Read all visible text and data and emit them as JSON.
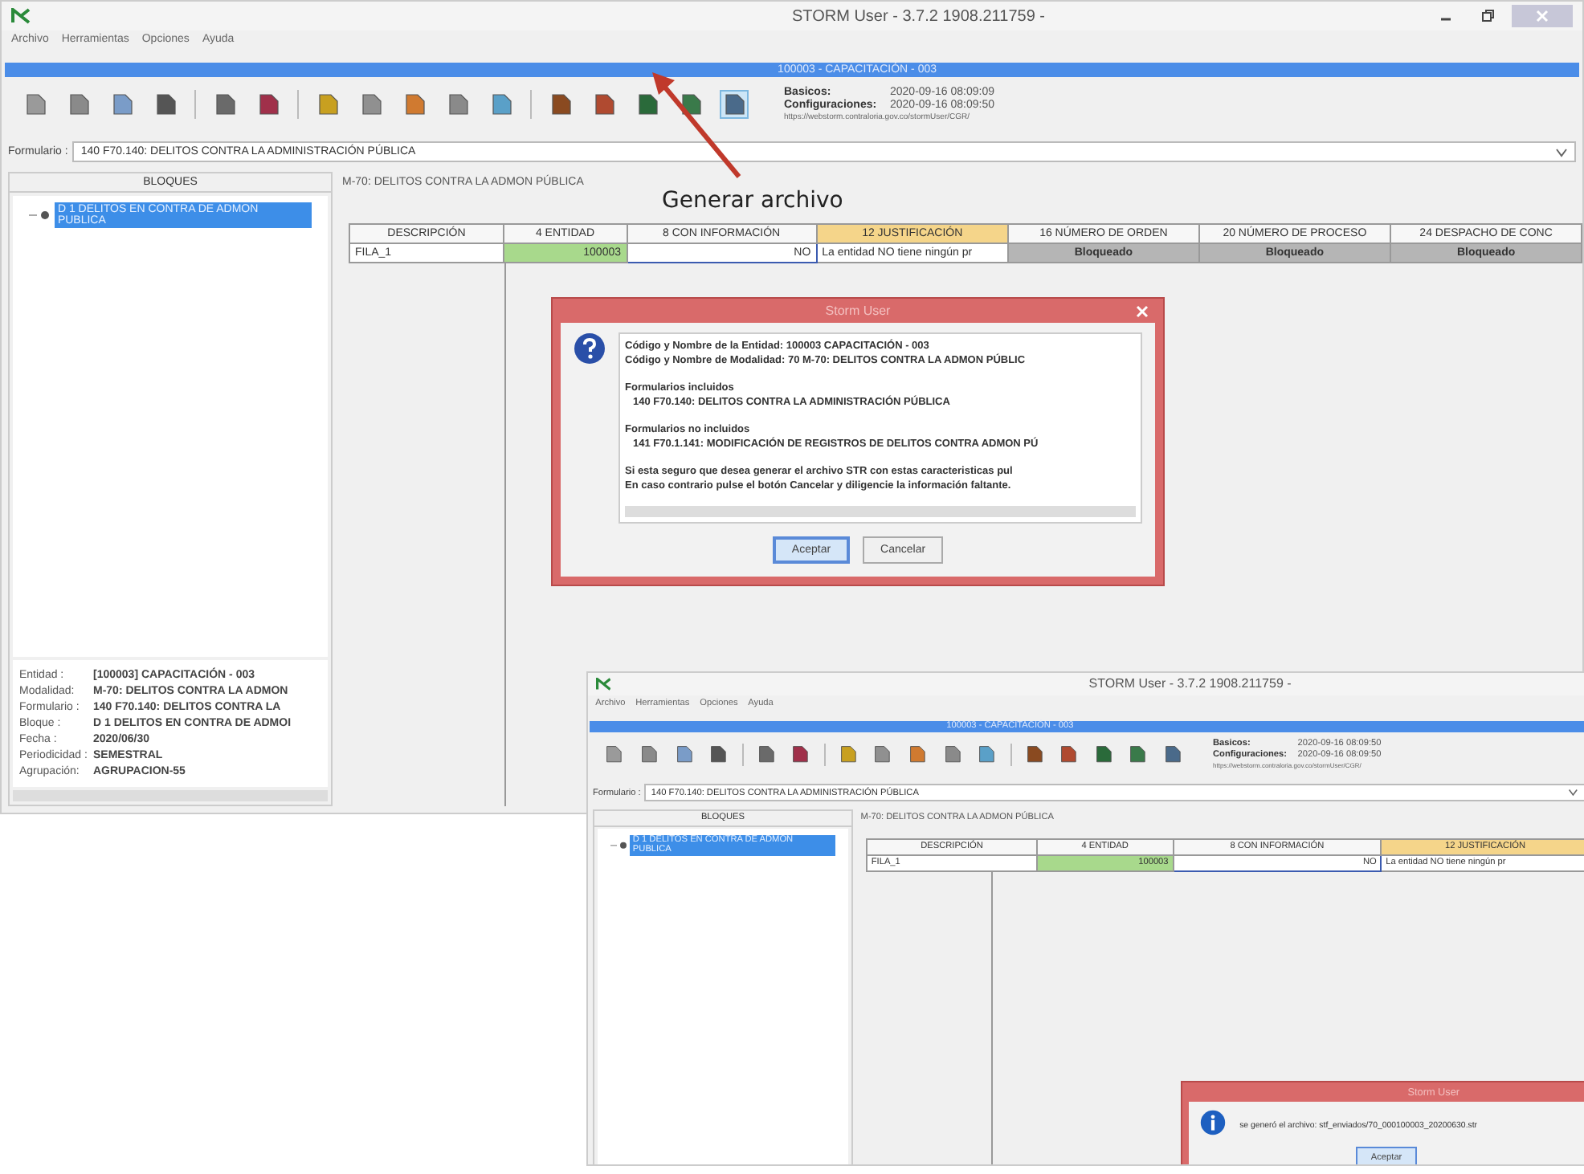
{
  "annotation": {
    "label": "Generar archivo"
  },
  "windows": [
    {
      "kind": "main",
      "title": "STORM User - 3.7.2  1908.211759 -",
      "controls": true,
      "menu": [
        "Archivo",
        "Herramientas",
        "Opciones",
        "Ayuda"
      ],
      "entity_bar": "100003 - CAPACITACIÓN - 003",
      "toolbar": [
        [
          {
            "color": "#9a9a9a",
            "selected": false
          },
          {
            "color": "#8a8a8a",
            "selected": false
          },
          {
            "color": "#7a9cc8",
            "selected": false
          },
          {
            "color": "#555555",
            "selected": false
          }
        ],
        [
          {
            "color": "#6a6a6a",
            "selected": false
          },
          {
            "color": "#a0304a",
            "selected": false
          }
        ],
        [
          {
            "color": "#c8a020",
            "selected": false
          },
          {
            "color": "#909090",
            "selected": false
          },
          {
            "color": "#d07a30",
            "selected": false
          },
          {
            "color": "#8a8a8a",
            "selected": false
          },
          {
            "color": "#5aa0c8",
            "selected": false
          }
        ],
        [
          {
            "color": "#8a4a20",
            "selected": false
          },
          {
            "color": "#b04a30",
            "selected": false
          },
          {
            "color": "#2a6a3a",
            "selected": false
          },
          {
            "color": "#3a7a4a",
            "selected": false
          },
          {
            "color": "#4a6a8a",
            "selected": true
          }
        ]
      ],
      "info": [
        {
          "label": "Basicos:",
          "value": "2020-09-16 08:09:09"
        },
        {
          "label": "Configuraciones:",
          "value": "2020-09-16 08:09:50"
        }
      ],
      "url": "https://webstorm.contraloria.gov.co/stormUser/CGR/",
      "formulario": {
        "label": "Formulario :",
        "value": "140 F70.140: DELITOS CONTRA LA ADMINISTRACIÓN PÚBLICA"
      },
      "blocks_header": "BLOQUES",
      "tree": [
        {
          "label": "D 1 DELITOS EN CONTRA DE ADMON PUBLICA",
          "selected": true
        }
      ],
      "grid_title": "M-70: DELITOS CONTRA LA ADMON PÚBLICA",
      "columns": [
        {
          "label": "DESCRIPCIÓN",
          "highlighted": false
        },
        {
          "label": "4 ENTIDAD",
          "highlighted": false
        },
        {
          "label": "8 CON INFORMACIÓN",
          "highlighted": false
        },
        {
          "label": "12 JUSTIFICACIÓN",
          "highlighted": true
        },
        {
          "label": "16 NÚMERO DE ORDEN",
          "highlighted": false
        },
        {
          "label": "20 NÚMERO DE PROCESO",
          "highlighted": false
        },
        {
          "label": "24 DESPACHO DE CONC",
          "highlighted": false
        }
      ],
      "rows": [
        [
          {
            "text": "FILA_1",
            "kind": "label"
          },
          {
            "text": "100003",
            "kind": "valid"
          },
          {
            "text": "NO",
            "kind": "input"
          },
          {
            "text": "La entidad NO tiene ningún pr",
            "kind": "note"
          },
          {
            "text": "Bloqueado",
            "kind": "blocked"
          },
          {
            "text": "Bloqueado",
            "kind": "blocked"
          },
          {
            "text": "Bloqueado",
            "kind": "blocked"
          }
        ]
      ],
      "details": [
        {
          "label": "Entidad :",
          "value": "[100003] CAPACITACIÓN - 003"
        },
        {
          "label": "Modalidad:",
          "value": "M-70: DELITOS CONTRA LA ADMON"
        },
        {
          "label": "Formulario :",
          "value": "140 F70.140: DELITOS CONTRA LA"
        },
        {
          "label": "Bloque :",
          "value": "D 1 DELITOS EN CONTRA DE ADMOI"
        },
        {
          "label": "Fecha :",
          "value": "2020/06/30"
        },
        {
          "label": "Periodicidad :",
          "value": "SEMESTRAL"
        },
        {
          "label": "Agrupación:",
          "value": "AGRUPACION-55"
        }
      ],
      "dialog": {
        "title": "Storm User",
        "kind": "question",
        "paragraphs": [
          [
            {
              "text": "Código y Nombre de la Entidad: 100003 CAPACITACIÓN - 003",
              "indent": false
            },
            {
              "text": "Código y Nombre de Modalidad:  70 M-70: DELITOS CONTRA LA ADMON PÚBLIC",
              "indent": false
            }
          ],
          [
            {
              "text": "Formularios incluidos",
              "indent": false
            },
            {
              "text": "140  F70.140:  DELITOS CONTRA LA ADMINISTRACIÓN PÚBLICA",
              "indent": true
            }
          ],
          [
            {
              "text": "Formularios no incluidos",
              "indent": false
            },
            {
              "text": "141 F70.1.141:  MODIFICACIÓN DE REGISTROS DE DELITOS CONTRA ADMON PÚ",
              "indent": true
            }
          ],
          [
            {
              "text": "Si esta seguro que desea generar el archivo STR con estas caracteristicas pul",
              "indent": false
            },
            {
              "text": "En caso contrario pulse el botón Cancelar y diligencie la información faltante.",
              "indent": false
            }
          ]
        ],
        "buttons": [
          {
            "label": "Aceptar",
            "selected": true
          },
          {
            "label": "Cancelar",
            "selected": false
          }
        ]
      }
    },
    {
      "kind": "result",
      "title": "STORM User - 3.7.2  1908.211759 -",
      "controls": false,
      "menu": [
        "Archivo",
        "Herramientas",
        "Opciones",
        "Ayuda"
      ],
      "entity_bar": "100003 - CAPACITACIÓN - 003",
      "toolbar": [
        [
          {
            "color": "#9a9a9a",
            "selected": false
          },
          {
            "color": "#8a8a8a",
            "selected": false
          },
          {
            "color": "#7a9cc8",
            "selected": false
          },
          {
            "color": "#555555",
            "selected": false
          }
        ],
        [
          {
            "color": "#6a6a6a",
            "selected": false
          },
          {
            "color": "#a0304a",
            "selected": false
          }
        ],
        [
          {
            "color": "#c8a020",
            "selected": false
          },
          {
            "color": "#909090",
            "selected": false
          },
          {
            "color": "#d07a30",
            "selected": false
          },
          {
            "color": "#8a8a8a",
            "selected": false
          },
          {
            "color": "#5aa0c8",
            "selected": false
          }
        ],
        [
          {
            "color": "#8a4a20",
            "selected": false
          },
          {
            "color": "#b04a30",
            "selected": false
          },
          {
            "color": "#2a6a3a",
            "selected": false
          },
          {
            "color": "#3a7a4a",
            "selected": false
          },
          {
            "color": "#4a6a8a",
            "selected": false
          }
        ]
      ],
      "info": [
        {
          "label": "Basicos:",
          "value": "2020-09-16 08:09:50"
        },
        {
          "label": "Configuraciones:",
          "value": "2020-09-16 08:09:50"
        }
      ],
      "url": "https://webstorm.contraloria.gov.co/stormUser/CGR/",
      "formulario": {
        "label": "Formulario :",
        "value": "140 F70.140: DELITOS CONTRA LA ADMINISTRACIÓN PÚBLICA"
      },
      "blocks_header": "BLOQUES",
      "tree": [
        {
          "label": "D 1 DELITOS EN CONTRA DE ADMON PUBLICA",
          "selected": true
        }
      ],
      "grid_title": "M-70: DELITOS CONTRA LA ADMON PÚBLICA",
      "columns": [
        {
          "label": "DESCRIPCIÓN",
          "highlighted": false
        },
        {
          "label": "4 ENTIDAD",
          "highlighted": false
        },
        {
          "label": "8 CON INFORMACIÓN",
          "highlighted": false
        },
        {
          "label": "12 JUSTIFICACIÓN",
          "highlighted": true
        }
      ],
      "rows": [
        [
          {
            "text": "FILA_1",
            "kind": "label"
          },
          {
            "text": "100003",
            "kind": "valid"
          },
          {
            "text": "NO",
            "kind": "input"
          },
          {
            "text": "La entidad NO tiene ningún pr",
            "kind": "note"
          }
        ]
      ],
      "dialog": {
        "title": "Storm User",
        "kind": "info",
        "paragraphs": [
          [
            {
              "text": "se generó el archivo: stf_enviados/70_000100003_20200630.str",
              "indent": false
            }
          ]
        ],
        "buttons": [
          {
            "label": "Aceptar",
            "selected": true
          }
        ]
      }
    }
  ]
}
